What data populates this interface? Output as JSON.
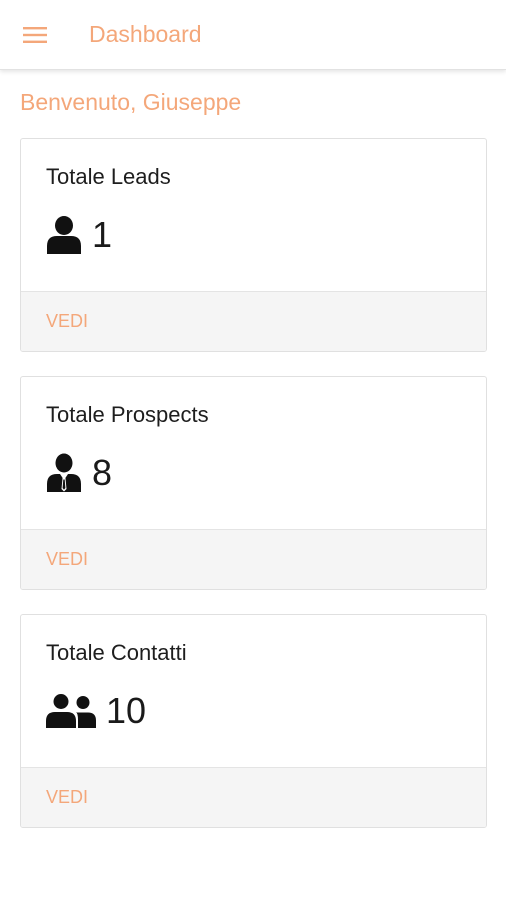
{
  "header": {
    "title": "Dashboard",
    "menu_icon": "hamburger-menu-icon"
  },
  "welcome": "Benvenuto, Giuseppe",
  "cards": [
    {
      "title": "Totale Leads",
      "value": "1",
      "icon": "user-icon",
      "action": "VEDI"
    },
    {
      "title": "Totale Prospects",
      "value": "8",
      "icon": "user-tie-icon",
      "action": "VEDI"
    },
    {
      "title": "Totale Contatti",
      "value": "10",
      "icon": "users-icon",
      "action": "VEDI"
    }
  ],
  "colors": {
    "accent": "#f4a77a",
    "text": "#1e1e1e",
    "footer_bg": "#f5f5f5",
    "border": "#e0e0e0"
  }
}
